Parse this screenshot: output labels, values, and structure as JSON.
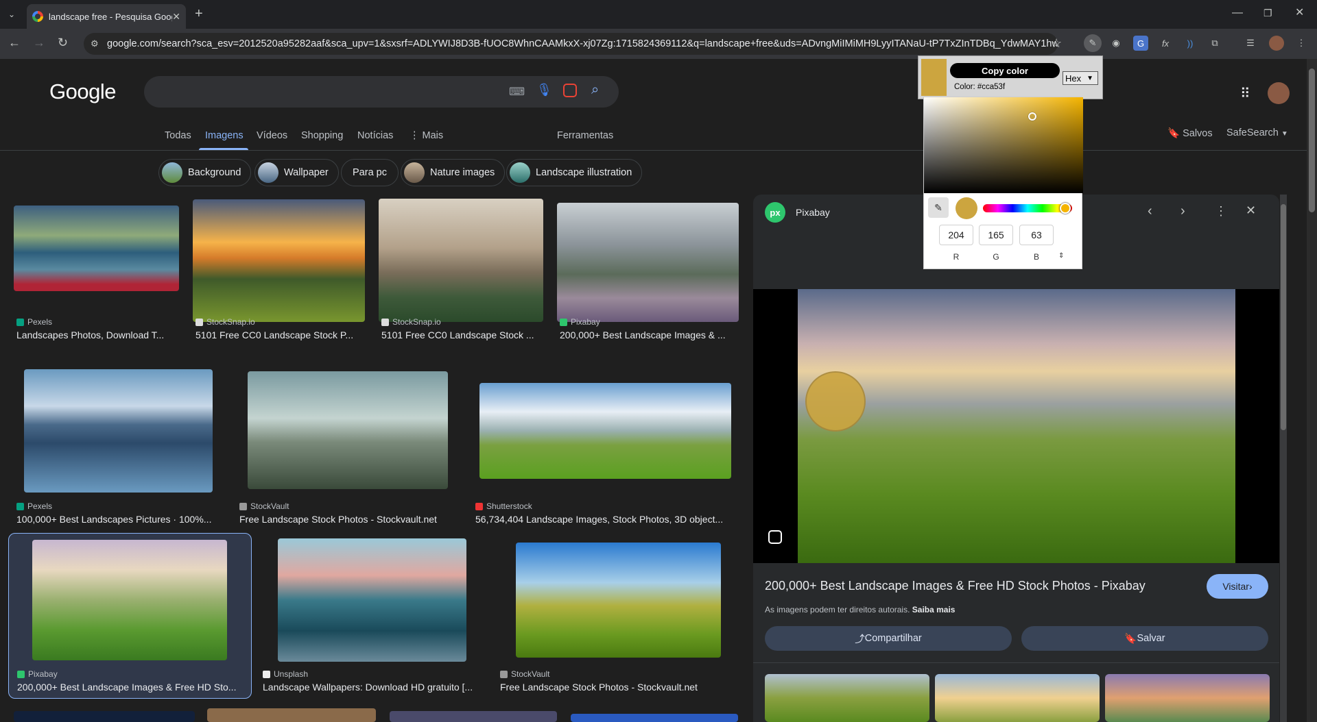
{
  "browser": {
    "tab_title": "landscape free - Pesquisa Goog",
    "url": "google.com/search?sca_esv=2012520a95282aaf&sca_upv=1&sxsrf=ADLYWIJ8D3B-fUOC8WhnCAAMkxX-xj07Zg:1715824369112&q=landscape+free&uds=ADvngMiIMiMH9LyyITANaU-tP7TxZInTDBq_YdwMAY1hw58Z3gO..."
  },
  "google": {
    "logo": "Google",
    "tabs": [
      "Todas",
      "Imagens",
      "Vídeos",
      "Shopping",
      "Notícias",
      "Mais"
    ],
    "tools": "Ferramentas",
    "saved": "Salvos",
    "safesearch": "SafeSearch"
  },
  "chips": [
    "Background",
    "Wallpaper",
    "Para pc",
    "Nature images",
    "Landscape illustration"
  ],
  "results": [
    {
      "source": "Pexels",
      "title": "Landscapes Photos, Download T..."
    },
    {
      "source": "StockSnap.io",
      "title": "5101 Free CC0 Landscape Stock P..."
    },
    {
      "source": "StockSnap.io",
      "title": "5101 Free CC0 Landscape Stock ..."
    },
    {
      "source": "Pixabay",
      "title": "200,000+ Best Landscape Images & ..."
    },
    {
      "source": "Pexels",
      "title": "100,000+ Best Landscapes Pictures · 100%..."
    },
    {
      "source": "StockVault",
      "title": "Free Landscape Stock Photos - Stockvault.net"
    },
    {
      "source": "Shutterstock",
      "title": "56,734,404 Landscape Images, Stock Photos, 3D object..."
    },
    {
      "source": "Pixabay",
      "title": "200,000+ Best Landscape Images & Free HD Sto..."
    },
    {
      "source": "Unsplash",
      "title": "Landscape Wallpapers: Download HD gratuito [..."
    },
    {
      "source": "StockVault",
      "title": "Free Landscape Stock Photos - Stockvault.net"
    }
  ],
  "preview": {
    "source": "Pixabay",
    "title": "200,000+ Best Landscape Images & Free HD Stock Photos - Pixabay",
    "visit": "Visitar",
    "rights": "As imagens podem ter direitos autorais.",
    "learn_more": "Saiba mais",
    "share": "Compartilhar",
    "save": "Salvar"
  },
  "color_picker": {
    "copy_label": "Copy color",
    "color_text": "Color: #cca53f",
    "format": "Hex",
    "swatch_color": "#cca53f",
    "r": "204",
    "g": "165",
    "b": "63",
    "r_label": "R",
    "g_label": "G",
    "b_label": "B"
  }
}
